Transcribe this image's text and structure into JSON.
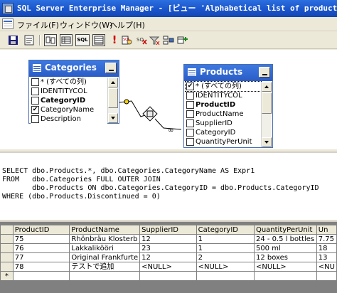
{
  "window": {
    "title": "SQL Server Enterprise Manager - [ビュー 'Alphabetical list of products' のデザ"
  },
  "menu": {
    "items": [
      "ファイル(F)",
      "ウィンドウ(W)",
      "ヘルプ(H)"
    ]
  },
  "toolbar": {
    "buttons": [
      "save",
      "properties",
      "show-diagram-pane",
      "show-grid-pane",
      "show-sql-pane",
      "show-results-pane",
      "run",
      "verify-sql",
      "remove-filter",
      "use-group-by",
      "add-table"
    ],
    "sql_label": "SQL"
  },
  "diagram": {
    "categories": {
      "title": "Categories",
      "columns": [
        {
          "name": "* (すべての列)",
          "checked": false
        },
        {
          "name": "IDENTITYCOL",
          "checked": false
        },
        {
          "name": "CategoryID",
          "checked": false,
          "bold": true
        },
        {
          "name": "CategoryName",
          "checked": true
        },
        {
          "name": "Description",
          "checked": false
        }
      ]
    },
    "products": {
      "title": "Products",
      "columns": [
        {
          "name": "* (すべての列)",
          "checked": true
        },
        {
          "name": "IDENTITYCOL",
          "checked": false
        },
        {
          "name": "ProductID",
          "checked": false,
          "bold": true
        },
        {
          "name": "ProductName",
          "checked": false
        },
        {
          "name": "SupplierID",
          "checked": false
        },
        {
          "name": "CategoryID",
          "checked": false
        },
        {
          "name": "QuantityPerUnit",
          "checked": false
        }
      ]
    }
  },
  "sql": {
    "lines": [
      "SELECT dbo.Products.*, dbo.Categories.CategoryName AS Expr1",
      "FROM   dbo.Categories FULL OUTER JOIN",
      "       dbo.Products ON dbo.Categories.CategoryID = dbo.Products.CategoryID",
      "WHERE (dbo.Products.Discontinued = 0)"
    ]
  },
  "grid": {
    "columns": [
      "ProductID",
      "ProductName",
      "SupplierID",
      "CategoryID",
      "QuantityPerUnit",
      "Un"
    ],
    "rows": [
      {
        "marker": "",
        "cells": [
          "75",
          "Rhönbräu Klosterb",
          "12",
          "1",
          "24 - 0.5 l bottles",
          "7.75"
        ]
      },
      {
        "marker": "",
        "cells": [
          "76",
          "Lakkalikööri",
          "23",
          "1",
          "500 ml",
          "18"
        ]
      },
      {
        "marker": "",
        "cells": [
          "77",
          "Original Frankfurte",
          "12",
          "2",
          "12 boxes",
          "13"
        ]
      },
      {
        "marker": "",
        "cells": [
          "78",
          "テストで追加",
          "<NULL>",
          "<NULL>",
          "<NULL>",
          "<NU"
        ]
      },
      {
        "marker": "*",
        "cells": [
          "",
          "",
          "",
          "",
          "",
          ""
        ]
      }
    ]
  }
}
